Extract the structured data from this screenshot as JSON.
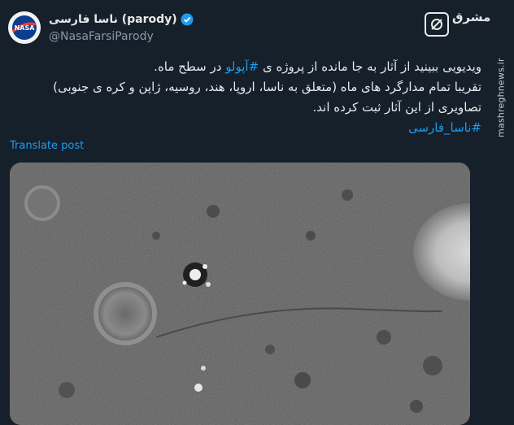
{
  "account": {
    "display_name": "ناسا فارسی (parody)",
    "handle": "@NasaFarsiParody",
    "avatar_icon": "nasa-logo-icon",
    "verified_icon": "verified-badge-icon"
  },
  "brand": {
    "logo_text": "مشرق",
    "logo_icon": "mashregh-logo-icon",
    "watermark": "mashreghnews.ir"
  },
  "tweet": {
    "line1_pre": "ویدیویی ببینید از آثار به جا مانده از پروژه ی ",
    "line1_tag": "#آپولو",
    "line1_post": " در سطح ماه.",
    "line2": "تقریبا تمام مدارگرد های ماه (متعلق به ناسا، اروپا، هند، روسیه، ژاپن و کره ی جنوبی)",
    "line3": "تصاویری از این آثار ثبت کرده اند.",
    "hashtag": "#ناسا_فارسی"
  },
  "translate_label": "Translate post",
  "media": {
    "description_icon": "lunar-surface-video-icon"
  },
  "colors": {
    "background": "#15202b",
    "text": "#e7e9ea",
    "secondary": "#8b98a5",
    "link": "#1d9bf0"
  }
}
